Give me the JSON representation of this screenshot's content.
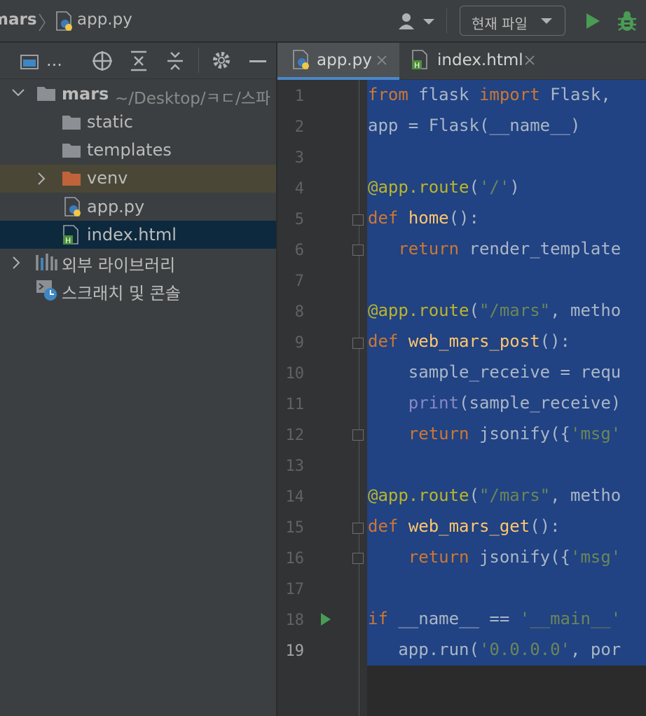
{
  "navbar": {
    "project_crumb": "mars",
    "file_crumb": "app.py",
    "run_config": "현재 파일"
  },
  "project": {
    "root_name": "mars",
    "root_path": "~/Desktop/ㅋㄷ/스파",
    "items": [
      {
        "label": "static"
      },
      {
        "label": "templates"
      },
      {
        "label": "venv"
      },
      {
        "label": "app.py"
      },
      {
        "label": "index.html"
      }
    ],
    "external_libraries": "외부 라이브러리",
    "scratches": "스크래치 및 콘솔",
    "toolbar_more": "..."
  },
  "tabs": [
    {
      "label": "app.py",
      "active": true
    },
    {
      "label": "index.html",
      "active": false
    }
  ],
  "editor": {
    "line_numbers": [
      "1",
      "2",
      "3",
      "4",
      "5",
      "6",
      "7",
      "8",
      "9",
      "10",
      "11",
      "12",
      "13",
      "14",
      "15",
      "16",
      "17",
      "18",
      "19"
    ],
    "lines": [
      "from flask import Flask,",
      "app = Flask(__name__)",
      "",
      "@app.route('/')",
      "def home():",
      "   return render_template",
      "",
      "@app.route(\"/mars\", metho",
      "def web_mars_post():",
      "    sample_receive = requ",
      "    print(sample_receive)",
      "    return jsonify({'msg'",
      "",
      "@app.route(\"/mars\", metho",
      "def web_mars_get():",
      "    return jsonify({'msg'",
      "",
      "if __name__ == '__main__'",
      "   app.run('0.0.0.0', por"
    ]
  },
  "colors": {
    "selection": "#214283",
    "keyword": "#cc7832",
    "decorator": "#bbb529",
    "function": "#ffc66d",
    "string": "#6a8759",
    "run_green": "#499c54",
    "folder_orange": "#c0633a"
  }
}
